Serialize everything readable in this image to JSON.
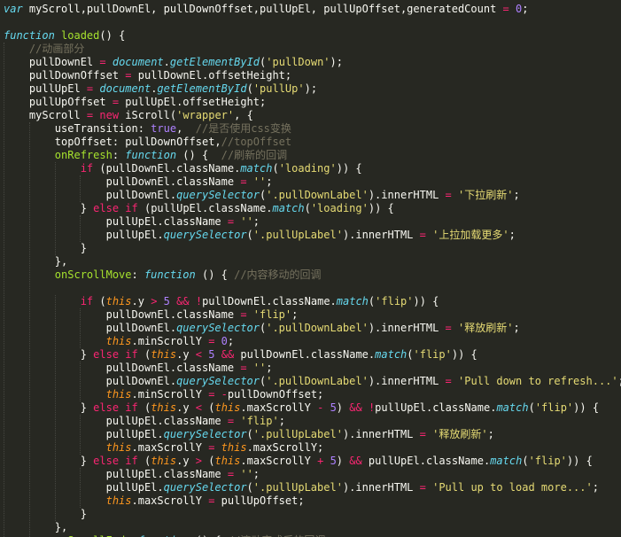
{
  "colors": {
    "background": "#272822",
    "plain": "#f8f8f2",
    "keyword": "#f92672",
    "storage": "#66d9ef",
    "function_name": "#a6e22e",
    "string": "#e6db74",
    "number": "#ae81ff",
    "comment": "#75715e",
    "this": "#fd971f"
  },
  "code_lines": [
    [
      {
        "t": "var",
        "c": "k"
      },
      {
        "t": " myScroll,pullDownEl, pullDownOffset,pullUpEl, pullUpOffset,generatedCount ",
        "c": "pl"
      },
      {
        "t": "=",
        "c": "op"
      },
      {
        "t": " ",
        "c": "pl"
      },
      {
        "t": "0",
        "c": "num"
      },
      {
        "t": ";",
        "c": "pl"
      }
    ],
    [],
    [
      {
        "t": "function",
        "c": "k"
      },
      {
        "t": " ",
        "c": "pl"
      },
      {
        "t": "loaded",
        "c": "fn"
      },
      {
        "t": "() {",
        "c": "pl"
      }
    ],
    [
      {
        "t": "    ",
        "c": "pl"
      },
      {
        "t": "//动画部分",
        "c": "cm"
      }
    ],
    [
      {
        "t": "    pullDownEl ",
        "c": "pl"
      },
      {
        "t": "=",
        "c": "op"
      },
      {
        "t": " ",
        "c": "pl"
      },
      {
        "t": "document",
        "c": "k"
      },
      {
        "t": ".",
        "c": "pl"
      },
      {
        "t": "getElementById",
        "c": "k"
      },
      {
        "t": "(",
        "c": "pl"
      },
      {
        "t": "'pullDown'",
        "c": "str"
      },
      {
        "t": ");",
        "c": "pl"
      }
    ],
    [
      {
        "t": "    pullDownOffset ",
        "c": "pl"
      },
      {
        "t": "=",
        "c": "op"
      },
      {
        "t": " pullDownEl.offsetHeight;",
        "c": "pl"
      }
    ],
    [
      {
        "t": "    pullUpEl ",
        "c": "pl"
      },
      {
        "t": "=",
        "c": "op"
      },
      {
        "t": " ",
        "c": "pl"
      },
      {
        "t": "document",
        "c": "k"
      },
      {
        "t": ".",
        "c": "pl"
      },
      {
        "t": "getElementById",
        "c": "k"
      },
      {
        "t": "(",
        "c": "pl"
      },
      {
        "t": "'pullUp'",
        "c": "str"
      },
      {
        "t": ");",
        "c": "pl"
      }
    ],
    [
      {
        "t": "    pullUpOffset ",
        "c": "pl"
      },
      {
        "t": "=",
        "c": "op"
      },
      {
        "t": " pullUpEl.offsetHeight;",
        "c": "pl"
      }
    ],
    [
      {
        "t": "    myScroll ",
        "c": "pl"
      },
      {
        "t": "=",
        "c": "op"
      },
      {
        "t": " ",
        "c": "pl"
      },
      {
        "t": "new",
        "c": "kw"
      },
      {
        "t": " iScroll(",
        "c": "pl"
      },
      {
        "t": "'wrapper'",
        "c": "str"
      },
      {
        "t": ", {",
        "c": "pl"
      }
    ],
    [
      {
        "t": "        useTransition: ",
        "c": "pl"
      },
      {
        "t": "true",
        "c": "num"
      },
      {
        "t": ",  ",
        "c": "pl"
      },
      {
        "t": "//是否使用css变换",
        "c": "cm"
      }
    ],
    [
      {
        "t": "        topOffset: pullDownOffset,",
        "c": "pl"
      },
      {
        "t": "//topOffset",
        "c": "cm"
      }
    ],
    [
      {
        "t": "        ",
        "c": "pl"
      },
      {
        "t": "onRefresh",
        "c": "fn"
      },
      {
        "t": ": ",
        "c": "pl"
      },
      {
        "t": "function",
        "c": "k"
      },
      {
        "t": " () {  ",
        "c": "pl"
      },
      {
        "t": "//刷新的回调",
        "c": "cm"
      }
    ],
    [
      {
        "t": "            ",
        "c": "pl"
      },
      {
        "t": "if",
        "c": "kw"
      },
      {
        "t": " (pullDownEl.className.",
        "c": "pl"
      },
      {
        "t": "match",
        "c": "k"
      },
      {
        "t": "(",
        "c": "pl"
      },
      {
        "t": "'loading'",
        "c": "str"
      },
      {
        "t": ")) {",
        "c": "pl"
      }
    ],
    [
      {
        "t": "                pullDownEl.className ",
        "c": "pl"
      },
      {
        "t": "=",
        "c": "op"
      },
      {
        "t": " ",
        "c": "pl"
      },
      {
        "t": "''",
        "c": "str"
      },
      {
        "t": ";",
        "c": "pl"
      }
    ],
    [
      {
        "t": "                pullDownEl.",
        "c": "pl"
      },
      {
        "t": "querySelector",
        "c": "k"
      },
      {
        "t": "(",
        "c": "pl"
      },
      {
        "t": "'.pullDownLabel'",
        "c": "str"
      },
      {
        "t": ").innerHTML ",
        "c": "pl"
      },
      {
        "t": "=",
        "c": "op"
      },
      {
        "t": " ",
        "c": "pl"
      },
      {
        "t": "'下拉刷新'",
        "c": "str"
      },
      {
        "t": ";",
        "c": "pl"
      }
    ],
    [
      {
        "t": "            } ",
        "c": "pl"
      },
      {
        "t": "else",
        "c": "kw"
      },
      {
        "t": " ",
        "c": "pl"
      },
      {
        "t": "if",
        "c": "kw"
      },
      {
        "t": " (pullUpEl.className.",
        "c": "pl"
      },
      {
        "t": "match",
        "c": "k"
      },
      {
        "t": "(",
        "c": "pl"
      },
      {
        "t": "'loading'",
        "c": "str"
      },
      {
        "t": ")) {",
        "c": "pl"
      }
    ],
    [
      {
        "t": "                pullUpEl.className ",
        "c": "pl"
      },
      {
        "t": "=",
        "c": "op"
      },
      {
        "t": " ",
        "c": "pl"
      },
      {
        "t": "''",
        "c": "str"
      },
      {
        "t": ";",
        "c": "pl"
      }
    ],
    [
      {
        "t": "                pullUpEl.",
        "c": "pl"
      },
      {
        "t": "querySelector",
        "c": "k"
      },
      {
        "t": "(",
        "c": "pl"
      },
      {
        "t": "'.pullUpLabel'",
        "c": "str"
      },
      {
        "t": ").innerHTML ",
        "c": "pl"
      },
      {
        "t": "=",
        "c": "op"
      },
      {
        "t": " ",
        "c": "pl"
      },
      {
        "t": "'上拉加载更多'",
        "c": "str"
      },
      {
        "t": ";",
        "c": "pl"
      }
    ],
    [
      {
        "t": "            }",
        "c": "pl"
      }
    ],
    [
      {
        "t": "        },",
        "c": "pl"
      }
    ],
    [
      {
        "t": "        ",
        "c": "pl"
      },
      {
        "t": "onScrollMove",
        "c": "fn"
      },
      {
        "t": ": ",
        "c": "pl"
      },
      {
        "t": "function",
        "c": "k"
      },
      {
        "t": " () { ",
        "c": "pl"
      },
      {
        "t": "//内容移动的回调",
        "c": "cm"
      }
    ],
    [],
    [
      {
        "t": "            ",
        "c": "pl"
      },
      {
        "t": "if",
        "c": "kw"
      },
      {
        "t": " (",
        "c": "pl"
      },
      {
        "t": "this",
        "c": "th"
      },
      {
        "t": ".y ",
        "c": "pl"
      },
      {
        "t": ">",
        "c": "op"
      },
      {
        "t": " ",
        "c": "pl"
      },
      {
        "t": "5",
        "c": "num"
      },
      {
        "t": " ",
        "c": "pl"
      },
      {
        "t": "&&",
        "c": "op"
      },
      {
        "t": " ",
        "c": "pl"
      },
      {
        "t": "!",
        "c": "op"
      },
      {
        "t": "pullDownEl.className.",
        "c": "pl"
      },
      {
        "t": "match",
        "c": "k"
      },
      {
        "t": "(",
        "c": "pl"
      },
      {
        "t": "'flip'",
        "c": "str"
      },
      {
        "t": ")) {",
        "c": "pl"
      }
    ],
    [
      {
        "t": "                pullDownEl.className ",
        "c": "pl"
      },
      {
        "t": "=",
        "c": "op"
      },
      {
        "t": " ",
        "c": "pl"
      },
      {
        "t": "'flip'",
        "c": "str"
      },
      {
        "t": ";",
        "c": "pl"
      }
    ],
    [
      {
        "t": "                pullDownEl.",
        "c": "pl"
      },
      {
        "t": "querySelector",
        "c": "k"
      },
      {
        "t": "(",
        "c": "pl"
      },
      {
        "t": "'.pullDownLabel'",
        "c": "str"
      },
      {
        "t": ").innerHTML ",
        "c": "pl"
      },
      {
        "t": "=",
        "c": "op"
      },
      {
        "t": " ",
        "c": "pl"
      },
      {
        "t": "'释放刷新'",
        "c": "str"
      },
      {
        "t": ";",
        "c": "pl"
      }
    ],
    [
      {
        "t": "                ",
        "c": "pl"
      },
      {
        "t": "this",
        "c": "th"
      },
      {
        "t": ".minScrollY ",
        "c": "pl"
      },
      {
        "t": "=",
        "c": "op"
      },
      {
        "t": " ",
        "c": "pl"
      },
      {
        "t": "0",
        "c": "num"
      },
      {
        "t": ";",
        "c": "pl"
      }
    ],
    [
      {
        "t": "            } ",
        "c": "pl"
      },
      {
        "t": "else",
        "c": "kw"
      },
      {
        "t": " ",
        "c": "pl"
      },
      {
        "t": "if",
        "c": "kw"
      },
      {
        "t": " (",
        "c": "pl"
      },
      {
        "t": "this",
        "c": "th"
      },
      {
        "t": ".y ",
        "c": "pl"
      },
      {
        "t": "<",
        "c": "op"
      },
      {
        "t": " ",
        "c": "pl"
      },
      {
        "t": "5",
        "c": "num"
      },
      {
        "t": " ",
        "c": "pl"
      },
      {
        "t": "&&",
        "c": "op"
      },
      {
        "t": " pullDownEl.className.",
        "c": "pl"
      },
      {
        "t": "match",
        "c": "k"
      },
      {
        "t": "(",
        "c": "pl"
      },
      {
        "t": "'flip'",
        "c": "str"
      },
      {
        "t": ")) {",
        "c": "pl"
      }
    ],
    [
      {
        "t": "                pullDownEl.className ",
        "c": "pl"
      },
      {
        "t": "=",
        "c": "op"
      },
      {
        "t": " ",
        "c": "pl"
      },
      {
        "t": "''",
        "c": "str"
      },
      {
        "t": ";",
        "c": "pl"
      }
    ],
    [
      {
        "t": "                pullDownEl.",
        "c": "pl"
      },
      {
        "t": "querySelector",
        "c": "k"
      },
      {
        "t": "(",
        "c": "pl"
      },
      {
        "t": "'.pullDownLabel'",
        "c": "str"
      },
      {
        "t": ").innerHTML ",
        "c": "pl"
      },
      {
        "t": "=",
        "c": "op"
      },
      {
        "t": " ",
        "c": "pl"
      },
      {
        "t": "'Pull down to refresh...'",
        "c": "str"
      },
      {
        "t": ";",
        "c": "pl"
      }
    ],
    [
      {
        "t": "                ",
        "c": "pl"
      },
      {
        "t": "this",
        "c": "th"
      },
      {
        "t": ".minScrollY ",
        "c": "pl"
      },
      {
        "t": "=",
        "c": "op"
      },
      {
        "t": " ",
        "c": "pl"
      },
      {
        "t": "-",
        "c": "op"
      },
      {
        "t": "pullDownOffset;",
        "c": "pl"
      }
    ],
    [
      {
        "t": "            } ",
        "c": "pl"
      },
      {
        "t": "else",
        "c": "kw"
      },
      {
        "t": " ",
        "c": "pl"
      },
      {
        "t": "if",
        "c": "kw"
      },
      {
        "t": " (",
        "c": "pl"
      },
      {
        "t": "this",
        "c": "th"
      },
      {
        "t": ".y ",
        "c": "pl"
      },
      {
        "t": "<",
        "c": "op"
      },
      {
        "t": " (",
        "c": "pl"
      },
      {
        "t": "this",
        "c": "th"
      },
      {
        "t": ".maxScrollY ",
        "c": "pl"
      },
      {
        "t": "-",
        "c": "op"
      },
      {
        "t": " ",
        "c": "pl"
      },
      {
        "t": "5",
        "c": "num"
      },
      {
        "t": ") ",
        "c": "pl"
      },
      {
        "t": "&&",
        "c": "op"
      },
      {
        "t": " ",
        "c": "pl"
      },
      {
        "t": "!",
        "c": "op"
      },
      {
        "t": "pullUpEl.className.",
        "c": "pl"
      },
      {
        "t": "match",
        "c": "k"
      },
      {
        "t": "(",
        "c": "pl"
      },
      {
        "t": "'flip'",
        "c": "str"
      },
      {
        "t": ")) {",
        "c": "pl"
      }
    ],
    [
      {
        "t": "                pullUpEl.className ",
        "c": "pl"
      },
      {
        "t": "=",
        "c": "op"
      },
      {
        "t": " ",
        "c": "pl"
      },
      {
        "t": "'flip'",
        "c": "str"
      },
      {
        "t": ";",
        "c": "pl"
      }
    ],
    [
      {
        "t": "                pullUpEl.",
        "c": "pl"
      },
      {
        "t": "querySelector",
        "c": "k"
      },
      {
        "t": "(",
        "c": "pl"
      },
      {
        "t": "'.pullUpLabel'",
        "c": "str"
      },
      {
        "t": ").innerHTML ",
        "c": "pl"
      },
      {
        "t": "=",
        "c": "op"
      },
      {
        "t": " ",
        "c": "pl"
      },
      {
        "t": "'释放刷新'",
        "c": "str"
      },
      {
        "t": ";",
        "c": "pl"
      }
    ],
    [
      {
        "t": "                ",
        "c": "pl"
      },
      {
        "t": "this",
        "c": "th"
      },
      {
        "t": ".maxScrollY ",
        "c": "pl"
      },
      {
        "t": "=",
        "c": "op"
      },
      {
        "t": " ",
        "c": "pl"
      },
      {
        "t": "this",
        "c": "th"
      },
      {
        "t": ".maxScrollY;",
        "c": "pl"
      }
    ],
    [
      {
        "t": "            } ",
        "c": "pl"
      },
      {
        "t": "else",
        "c": "kw"
      },
      {
        "t": " ",
        "c": "pl"
      },
      {
        "t": "if",
        "c": "kw"
      },
      {
        "t": " (",
        "c": "pl"
      },
      {
        "t": "this",
        "c": "th"
      },
      {
        "t": ".y ",
        "c": "pl"
      },
      {
        "t": ">",
        "c": "op"
      },
      {
        "t": " (",
        "c": "pl"
      },
      {
        "t": "this",
        "c": "th"
      },
      {
        "t": ".maxScrollY ",
        "c": "pl"
      },
      {
        "t": "+",
        "c": "op"
      },
      {
        "t": " ",
        "c": "pl"
      },
      {
        "t": "5",
        "c": "num"
      },
      {
        "t": ") ",
        "c": "pl"
      },
      {
        "t": "&&",
        "c": "op"
      },
      {
        "t": " pullUpEl.className.",
        "c": "pl"
      },
      {
        "t": "match",
        "c": "k"
      },
      {
        "t": "(",
        "c": "pl"
      },
      {
        "t": "'flip'",
        "c": "str"
      },
      {
        "t": ")) {",
        "c": "pl"
      }
    ],
    [
      {
        "t": "                pullUpEl.className ",
        "c": "pl"
      },
      {
        "t": "=",
        "c": "op"
      },
      {
        "t": " ",
        "c": "pl"
      },
      {
        "t": "''",
        "c": "str"
      },
      {
        "t": ";",
        "c": "pl"
      }
    ],
    [
      {
        "t": "                pullUpEl.",
        "c": "pl"
      },
      {
        "t": "querySelector",
        "c": "k"
      },
      {
        "t": "(",
        "c": "pl"
      },
      {
        "t": "'.pullUpLabel'",
        "c": "str"
      },
      {
        "t": ").innerHTML ",
        "c": "pl"
      },
      {
        "t": "=",
        "c": "op"
      },
      {
        "t": " ",
        "c": "pl"
      },
      {
        "t": "'Pull up to load more...'",
        "c": "str"
      },
      {
        "t": ";",
        "c": "pl"
      }
    ],
    [
      {
        "t": "                ",
        "c": "pl"
      },
      {
        "t": "this",
        "c": "th"
      },
      {
        "t": ".maxScrollY ",
        "c": "pl"
      },
      {
        "t": "=",
        "c": "op"
      },
      {
        "t": " pullUpOffset;",
        "c": "pl"
      }
    ],
    [
      {
        "t": "            }",
        "c": "pl"
      }
    ],
    [
      {
        "t": "        },",
        "c": "pl"
      }
    ],
    [
      {
        "t": "        ",
        "c": "pl"
      },
      {
        "t": "onScrollEnd",
        "c": "fn"
      },
      {
        "t": ": ",
        "c": "pl"
      },
      {
        "t": "function",
        "c": "k"
      },
      {
        "t": " () { ",
        "c": "pl"
      },
      {
        "t": "//滚动完成后的回调",
        "c": "cm"
      }
    ]
  ]
}
